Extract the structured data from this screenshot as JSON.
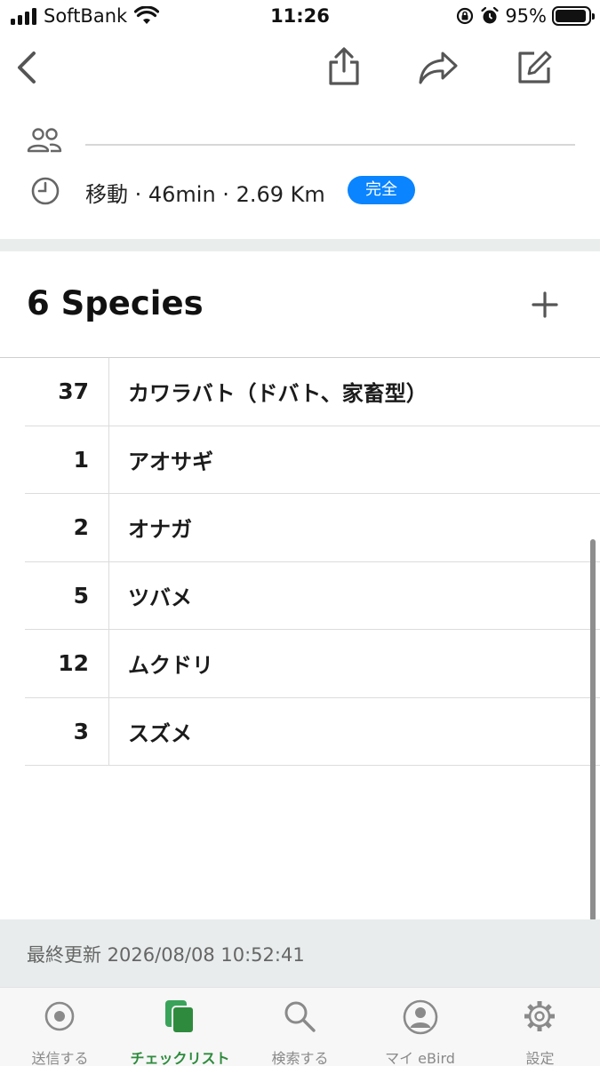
{
  "status_bar": {
    "carrier": "SoftBank",
    "time": "11:26",
    "battery_percent": "95%",
    "battery_level": 0.95
  },
  "nav": {
    "back_icon": "chevron-left-icon",
    "share_icon": "share-icon",
    "forward_icon": "forward-arrow-icon",
    "edit_icon": "edit-icon"
  },
  "trip": {
    "summary": "移動 · 46min · 2.69 Km",
    "status_badge": "完全",
    "badge_color": "#0a84ff"
  },
  "species_section": {
    "title": "6 Species",
    "add_icon": "plus-icon",
    "rows": [
      {
        "count": "37",
        "name": "カワラバト（ドバト、家畜型）"
      },
      {
        "count": "1",
        "name": "アオサギ"
      },
      {
        "count": "2",
        "name": "オナガ"
      },
      {
        "count": "5",
        "name": "ツバメ"
      },
      {
        "count": "12",
        "name": "ムクドリ"
      },
      {
        "count": "3",
        "name": "スズメ"
      }
    ]
  },
  "footer": {
    "last_updated": "最終更新 2026/08/08 10:52:41"
  },
  "tab_bar": {
    "accent_color": "#2e8b3d",
    "tabs": [
      {
        "label": "送信する",
        "icon": "record-icon"
      },
      {
        "label": "チェックリスト",
        "icon": "checklist-icon",
        "active": true
      },
      {
        "label": "検索する",
        "icon": "search-icon"
      },
      {
        "label": "マイ eBird",
        "icon": "profile-icon"
      },
      {
        "label": "設定",
        "icon": "gear-icon"
      }
    ]
  }
}
